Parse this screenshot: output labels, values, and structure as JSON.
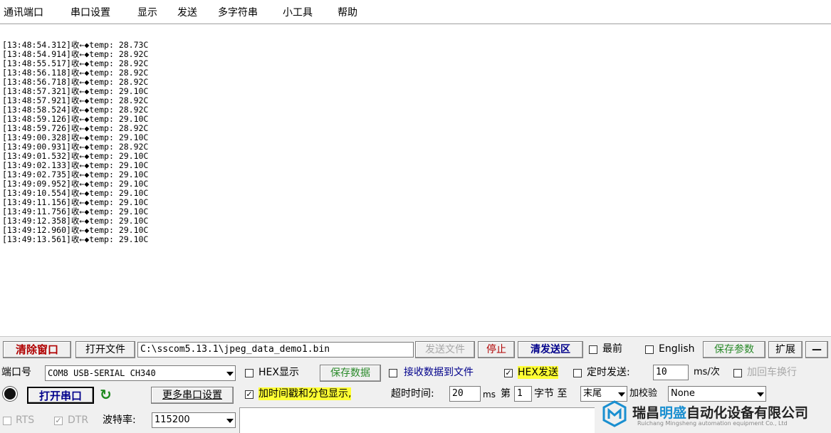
{
  "menu": [
    "通讯端口",
    "串口设置",
    "显示",
    "发送",
    "多字符串",
    "小工具",
    "帮助"
  ],
  "log": [
    "[13:48:54.312]收←◆temp: 28.73C",
    "[13:48:54.914]收←◆temp: 28.92C",
    "[13:48:55.517]收←◆temp: 28.92C",
    "[13:48:56.118]收←◆temp: 28.92C",
    "[13:48:56.718]收←◆temp: 28.92C",
    "[13:48:57.321]收←◆temp: 29.10C",
    "[13:48:57.921]收←◆temp: 28.92C",
    "[13:48:58.524]收←◆temp: 28.92C",
    "[13:48:59.126]收←◆temp: 29.10C",
    "[13:48:59.726]收←◆temp: 28.92C",
    "[13:49:00.328]收←◆temp: 29.10C",
    "[13:49:00.931]收←◆temp: 28.92C",
    "[13:49:01.532]收←◆temp: 29.10C",
    "[13:49:02.133]收←◆temp: 29.10C",
    "[13:49:02.735]收←◆temp: 29.10C",
    "[13:49:09.952]收←◆temp: 29.10C",
    "[13:49:10.554]收←◆temp: 29.10C",
    "[13:49:11.156]收←◆temp: 29.10C",
    "[13:49:11.756]收←◆temp: 29.10C",
    "[13:49:12.358]收←◆temp: 29.10C",
    "[13:49:12.960]收←◆temp: 29.10C",
    "[13:49:13.561]收←◆temp: 29.10C"
  ],
  "toolbar": {
    "clear_window": "清除窗口",
    "open_file": "打开文件",
    "file_path": "C:\\sscom5.13.1\\jpeg_data_demo1.bin",
    "send_file": "发送文件",
    "stop": "停止",
    "clear_send": "清发送区",
    "topmost": "最前",
    "english": "English",
    "save_params": "保存参数",
    "expand": "扩展",
    "collapse": "—"
  },
  "port": {
    "label": "端口号",
    "value": "COM8 USB-SERIAL CH340",
    "open_port": "打开串口",
    "more_settings": "更多串口设置",
    "rts": "RTS",
    "dtr": "DTR",
    "baud_label": "波特率:",
    "baud_value": "115200"
  },
  "options": {
    "hex_display": "HEX显示",
    "save_data": "保存数据",
    "recv_to_file": "接收数据到文件",
    "hex_send": "HEX发送",
    "timed_send": "定时发送:",
    "interval": "10",
    "interval_unit": "ms/次",
    "add_crlf": "加回车换行",
    "timestamp": "加时间戳和分包显示,",
    "timeout_label": "超时时间:",
    "timeout_value": "20",
    "timeout_unit": "ms",
    "byte_prefix": "第",
    "byte_index": "1",
    "byte_label": "字节 至",
    "byte_end": "末尾",
    "checksum_label": "加校验",
    "checksum_value": "None"
  },
  "brand": {
    "name_prefix": "瑞昌",
    "name_highlight": "明盛",
    "name_suffix": "自动化设备有限公司",
    "subtitle": "Ruichang Mingsheng automation equipment Co., Ltd"
  },
  "colors": {
    "accent_green": "#2a8a2a",
    "alert_red": "#b00000",
    "highlight_yellow": "#ffff33",
    "brand_blue": "#1a8fd0"
  }
}
